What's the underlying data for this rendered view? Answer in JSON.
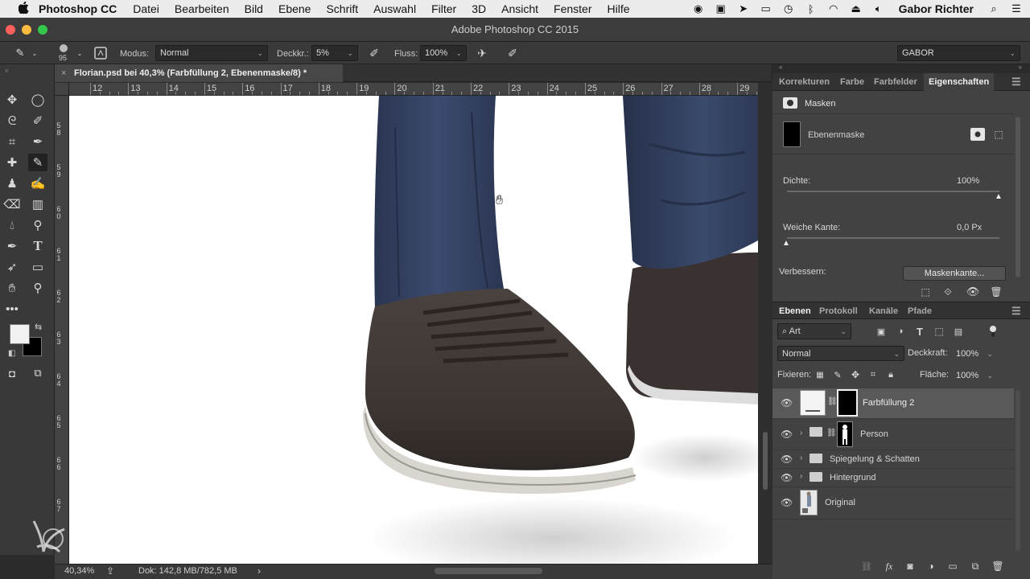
{
  "menubar": {
    "apple": "",
    "app_name": "Photoshop CC",
    "items": [
      "Datei",
      "Bearbeiten",
      "Bild",
      "Ebene",
      "Schrift",
      "Auswahl",
      "Filter",
      "3D",
      "Ansicht",
      "Fenster",
      "Hilfe"
    ],
    "user_name": "Gabor Richter"
  },
  "window": {
    "title": "Adobe Photoshop CC 2015"
  },
  "options_bar": {
    "brush_size": "95",
    "mode_label": "Modus:",
    "mode_value": "Normal",
    "opacity_label": "Deckkr.:",
    "opacity_value": "5%",
    "flow_label": "Fluss:",
    "flow_value": "100%",
    "workspace_value": "GABOR"
  },
  "document_tab": {
    "close": "×",
    "title": "Florian.psd bei 40,3% (Farbfüllung 2, Ebenenmaske/8) *"
  },
  "ruler_top": [
    "12",
    "13",
    "14",
    "15",
    "16",
    "17",
    "18",
    "19",
    "20",
    "21",
    "22",
    "23",
    "24",
    "25",
    "26",
    "27",
    "28",
    "29"
  ],
  "ruler_left": [
    [
      "5",
      "8"
    ],
    [
      "5",
      "9"
    ],
    [
      "6",
      "0"
    ],
    [
      "6",
      "1"
    ],
    [
      "6",
      "2"
    ],
    [
      "6",
      "3"
    ],
    [
      "6",
      "4"
    ],
    [
      "6",
      "5"
    ],
    [
      "6",
      "6"
    ],
    [
      "6",
      "7"
    ]
  ],
  "status_bar": {
    "zoom": "40,34%",
    "doc": "Dok: 142,8 MB/782,5 MB",
    "arrow": "›"
  },
  "panel_tabs_top": {
    "items": [
      "Korrekturen",
      "Farbe",
      "Farbfelder",
      "Eigenschaften"
    ],
    "active": 3
  },
  "properties": {
    "section": "Masken",
    "mask_type": "Ebenenmaske",
    "density_label": "Dichte:",
    "density_value": "100%",
    "density_level": 1.0,
    "feather_label": "Weiche Kante:",
    "feather_value": "0,0 Px",
    "feather_level": 0.0,
    "refine_label": "Verbessern:",
    "refine_button": "Maskenkante..."
  },
  "panel_tabs_bottom": {
    "items": [
      "Ebenen",
      "Protokoll",
      "Kanäle",
      "Pfade"
    ],
    "active": 0
  },
  "layers": {
    "filter_value": "Art",
    "blend_mode": "Normal",
    "opacity_label": "Deckkraft:",
    "opacity_value": "100%",
    "lock_label": "Fixieren:",
    "fill_label": "Fläche:",
    "fill_value": "100%",
    "items": [
      {
        "name": "Farbfüllung 2",
        "selected": true
      },
      {
        "name": "Person",
        "selected": false
      },
      {
        "name": "Spiegelung & Schatten",
        "selected": false
      },
      {
        "name": "Hintergrund",
        "selected": false
      },
      {
        "name": "Original",
        "selected": false
      }
    ]
  },
  "colors": {
    "foreground": "#f2f2f2",
    "background": "#000000",
    "accent_selected_layer": "#595959",
    "panel": "#424242"
  }
}
